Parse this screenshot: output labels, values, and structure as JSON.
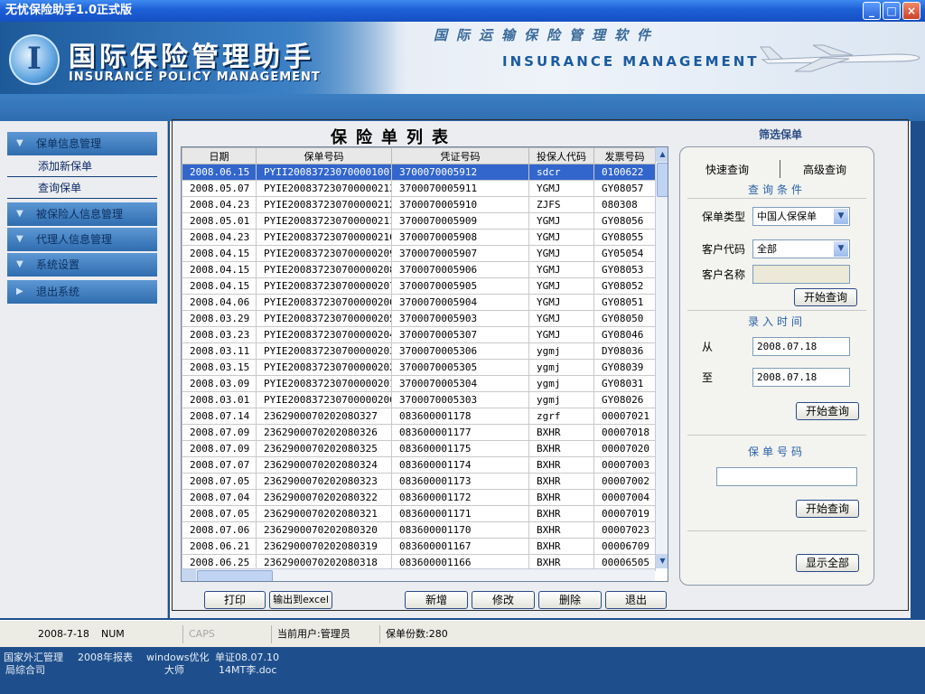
{
  "window": {
    "title": "无忧保险助手1.0正式版",
    "min": "_",
    "max": "□",
    "close": "×"
  },
  "banner": {
    "logo_letter": "I",
    "app_name": "国际保险管理助手",
    "app_sub": "INSURANCE POLICY MANAGEMENT",
    "cn_slogan": "国际运输保险管理软件",
    "en_slogan": "INSURANCE MANAGEMENT"
  },
  "sidebar": {
    "items": [
      {
        "label": "保单信息管理",
        "type": "head"
      },
      {
        "label": "添加新保单",
        "type": "sub"
      },
      {
        "label": "查询保单",
        "type": "sub"
      },
      {
        "label": "被保险人信息管理",
        "type": "head"
      },
      {
        "label": "代理人信息管理",
        "type": "head"
      },
      {
        "label": "系统设置",
        "type": "head"
      },
      {
        "label": "退出系统",
        "type": "head"
      }
    ]
  },
  "list": {
    "title": "保险单列表",
    "columns": [
      "日期",
      "保单号码",
      "凭证号码",
      "投保人代码",
      "发票号码"
    ],
    "rows": [
      [
        "2008.06.15",
        "PYII20083723070000100l",
        "3700070005912",
        "sdcr",
        "0100622"
      ],
      [
        "2008.05.07",
        "PYIE200837230700000213",
        "3700070005911",
        "YGMJ",
        "GY08057"
      ],
      [
        "2008.04.23",
        "PYIE200837230700000212",
        "3700070005910",
        "ZJFS",
        "080308"
      ],
      [
        "2008.05.01",
        "PYIE200837230700000211",
        "3700070005909",
        "YGMJ",
        "GY08056"
      ],
      [
        "2008.04.23",
        "PYIE200837230700000210",
        "3700070005908",
        "YGMJ",
        "GY08055"
      ],
      [
        "2008.04.15",
        "PYIE200837230700000209",
        "3700070005907",
        "YGMJ",
        "GY05054"
      ],
      [
        "2008.04.15",
        "PYIE200837230700000208",
        "3700070005906",
        "YGMJ",
        "GY08053"
      ],
      [
        "2008.04.15",
        "PYIE200837230700000207",
        "3700070005905",
        "YGMJ",
        "GY08052"
      ],
      [
        "2008.04.06",
        "PYIE200837230700000206",
        "3700070005904",
        "YGMJ",
        "GY08051"
      ],
      [
        "2008.03.29",
        "PYIE200837230700000205",
        "3700070005903",
        "YGMJ",
        "GY08050"
      ],
      [
        "2008.03.23",
        "PYIE200837230700000204",
        "3700070005307",
        "YGMJ",
        "GY08046"
      ],
      [
        "2008.03.11",
        "PYIE200837230700000203",
        "3700070005306",
        "ygmj",
        "DY08036"
      ],
      [
        "2008.03.15",
        "PYIE200837230700000202",
        "3700070005305",
        "ygmj",
        "GY08039"
      ],
      [
        "2008.03.09",
        "PYIE200837230700000201",
        "3700070005304",
        "ygmj",
        "GY08031"
      ],
      [
        "2008.03.01",
        "PYIE200837230700000200",
        "3700070005303",
        "ygmj",
        "GY08026"
      ],
      [
        "2008.07.14",
        "236290007020208O327",
        "083600001178",
        "zgrf",
        "00007021"
      ],
      [
        "2008.07.09",
        "2362900070202080326",
        "083600001177",
        "BXHR",
        "00007018"
      ],
      [
        "2008.07.09",
        "2362900070202080325",
        "083600001175",
        "BXHR",
        "00007020"
      ],
      [
        "2008.07.07",
        "2362900070202080324",
        "083600001174",
        "BXHR",
        "00007003"
      ],
      [
        "2008.07.05",
        "2362900070202080323",
        "083600001173",
        "BXHR",
        "00007002"
      ],
      [
        "2008.07.04",
        "2362900070202080322",
        "083600001172",
        "BXHR",
        "00007004"
      ],
      [
        "2008.07.05",
        "2362900070202080321",
        "083600001171",
        "BXHR",
        "00007019"
      ],
      [
        "2008.07.06",
        "2362900070202080320",
        "083600001170",
        "BXHR",
        "00007023"
      ],
      [
        "2008.06.21",
        "2362900070202080319",
        "083600001167",
        "BXHR",
        "00006709"
      ],
      [
        "2008.06.25",
        "2362900070202080318",
        "083600001166",
        "BXHR",
        "00006505"
      ]
    ],
    "selected_row": 0
  },
  "actions": {
    "print": "打印",
    "export": "输出到excel",
    "add": "新增",
    "edit": "修改",
    "delete": "删除",
    "exit": "退出"
  },
  "filter": {
    "title": "筛选保单",
    "tab_quick": "快速查询",
    "tab_advanced": "高级查询",
    "cond_title": "查询条件",
    "type_label": "保单类型",
    "type_value": "中国人保保单",
    "code_label": "客户代码",
    "code_value": "全部",
    "name_label": "客户名称",
    "name_value": "",
    "search1": "开始查询",
    "time_title": "录入时间",
    "from_label": "从",
    "from_value": "2008.07.18",
    "to_label": "至",
    "to_value": "2008.07.18",
    "search2": "开始查询",
    "policy_title": "保单号码",
    "policy_value": "",
    "search3": "开始查询",
    "show_all": "显示全部"
  },
  "status": {
    "date": "2008-7-18",
    "num": "NUM",
    "caps": "CAPS",
    "user": "当前用户:管理员",
    "count": "保单份数:280"
  },
  "desktop": {
    "line1": [
      "国家外汇管理",
      "2008年报表",
      "windows优化",
      "单证08.07.10"
    ],
    "line2": [
      "局综合司",
      "大师",
      "14MT李.doc"
    ]
  },
  "colors": {
    "accent": "#3366cc",
    "banner": "#2f6db0",
    "border": "#2a4a86"
  }
}
